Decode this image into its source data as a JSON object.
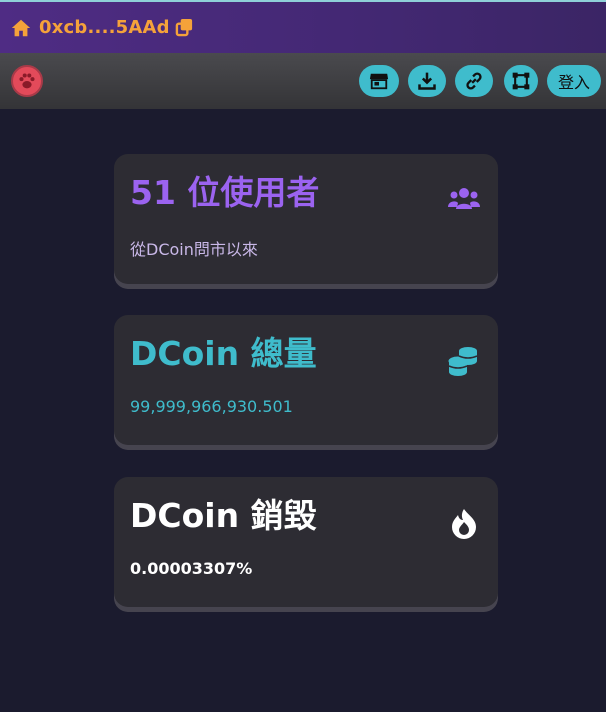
{
  "header": {
    "address": "0xcb....5AAd",
    "icons": [
      "home-icon",
      "copy-icon"
    ]
  },
  "toolbar": {
    "logo_icon": "paw-icon",
    "buttons": [
      "store-icon",
      "download-icon",
      "link-icon",
      "expand-icon"
    ],
    "login_label": "登入"
  },
  "cards": [
    {
      "title": "51 位使用者",
      "subtitle": "從DCoin問市以來",
      "icon": "users-icon",
      "color": "#9b63f0",
      "subcolor": "#c9b8e8"
    },
    {
      "title": "DCoin 總量",
      "subtitle": "99,999,966,930.501",
      "icon": "coins-icon",
      "color": "#3fbccc",
      "subcolor": "#3fbccc"
    },
    {
      "title": "DCoin 銷毀",
      "subtitle": "0.00003307%",
      "icon": "fire-icon",
      "color": "#ffffff",
      "subcolor": "#ffffff"
    }
  ]
}
